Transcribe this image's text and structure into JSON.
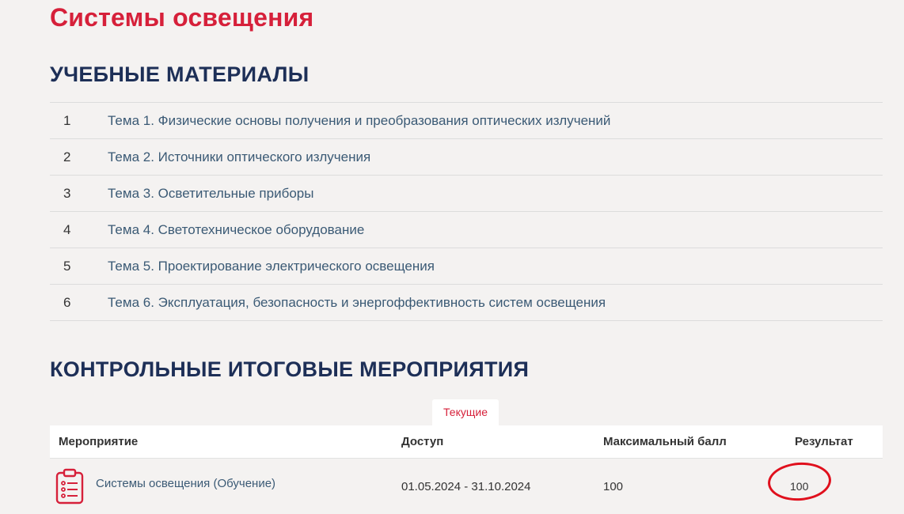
{
  "page": {
    "title": "Системы освещения"
  },
  "materials": {
    "heading": "УЧЕБНЫЕ МАТЕРИАЛЫ",
    "items": [
      {
        "num": "1",
        "label": "Тема 1. Физические основы получения и преобразования оптических излучений"
      },
      {
        "num": "2",
        "label": "Тема 2. Источники оптического излучения"
      },
      {
        "num": "3",
        "label": "Тема 3. Осветительные приборы"
      },
      {
        "num": "4",
        "label": "Тема 4. Светотехническое оборудование"
      },
      {
        "num": "5",
        "label": "Тема 5. Проектирование электрического освещения"
      },
      {
        "num": "6",
        "label": "Тема 6. Эксплуатация, безопасность и энергоффективность систем освещения"
      }
    ]
  },
  "events": {
    "heading": "КОНТРОЛЬНЫЕ ИТОГОВЫЕ МЕРОПРИЯТИЯ",
    "tab_current": "Текущие",
    "columns": {
      "event": "Мероприятие",
      "access": "Доступ",
      "max_score": "Максимальный балл",
      "result": "Результат"
    },
    "rows": [
      {
        "icon": "test-checklist-icon",
        "name": "Системы освещения (Обучение)",
        "access": "01.05.2024 - 31.10.2024",
        "max_score": "100",
        "result": "100"
      }
    ]
  },
  "colors": {
    "accent_red": "#d6203a",
    "heading_navy": "#1d2f57",
    "link_blue": "#3b5a75",
    "annotation_circle": "#e0101d",
    "background": "#f4f2f1"
  }
}
